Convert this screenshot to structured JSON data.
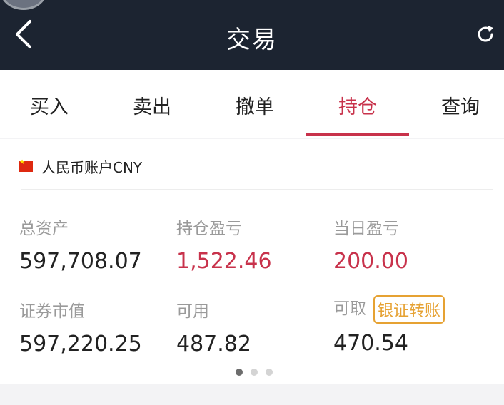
{
  "header": {
    "title": "交易"
  },
  "tabs": [
    {
      "label": "买入",
      "active": false
    },
    {
      "label": "卖出",
      "active": false
    },
    {
      "label": "撤单",
      "active": false
    },
    {
      "label": "持仓",
      "active": true
    },
    {
      "label": "查询",
      "active": false
    }
  ],
  "account": {
    "label": "人民币账户CNY"
  },
  "metrics": {
    "total_assets": {
      "label": "总资产",
      "value": "597,708.07"
    },
    "position_pnl": {
      "label": "持仓盈亏",
      "value": "1,522.46"
    },
    "daily_pnl": {
      "label": "当日盈亏",
      "value": "200.00"
    },
    "market_value": {
      "label": "证券市值",
      "value": "597,220.25"
    },
    "available": {
      "label": "可用",
      "value": "487.82"
    },
    "withdrawable": {
      "label": "可取",
      "value": "470.54"
    }
  },
  "transfer_button": {
    "label": "银证转账"
  },
  "pager": {
    "count": 3,
    "active_index": 0
  },
  "colors": {
    "nav_bg": "#1c2431",
    "accent_red": "#c8324b",
    "transfer_orange": "#e6a233"
  },
  "icons": {
    "back": "chevron-left-icon",
    "refresh": "refresh-icon",
    "flag": "china-flag-icon"
  }
}
